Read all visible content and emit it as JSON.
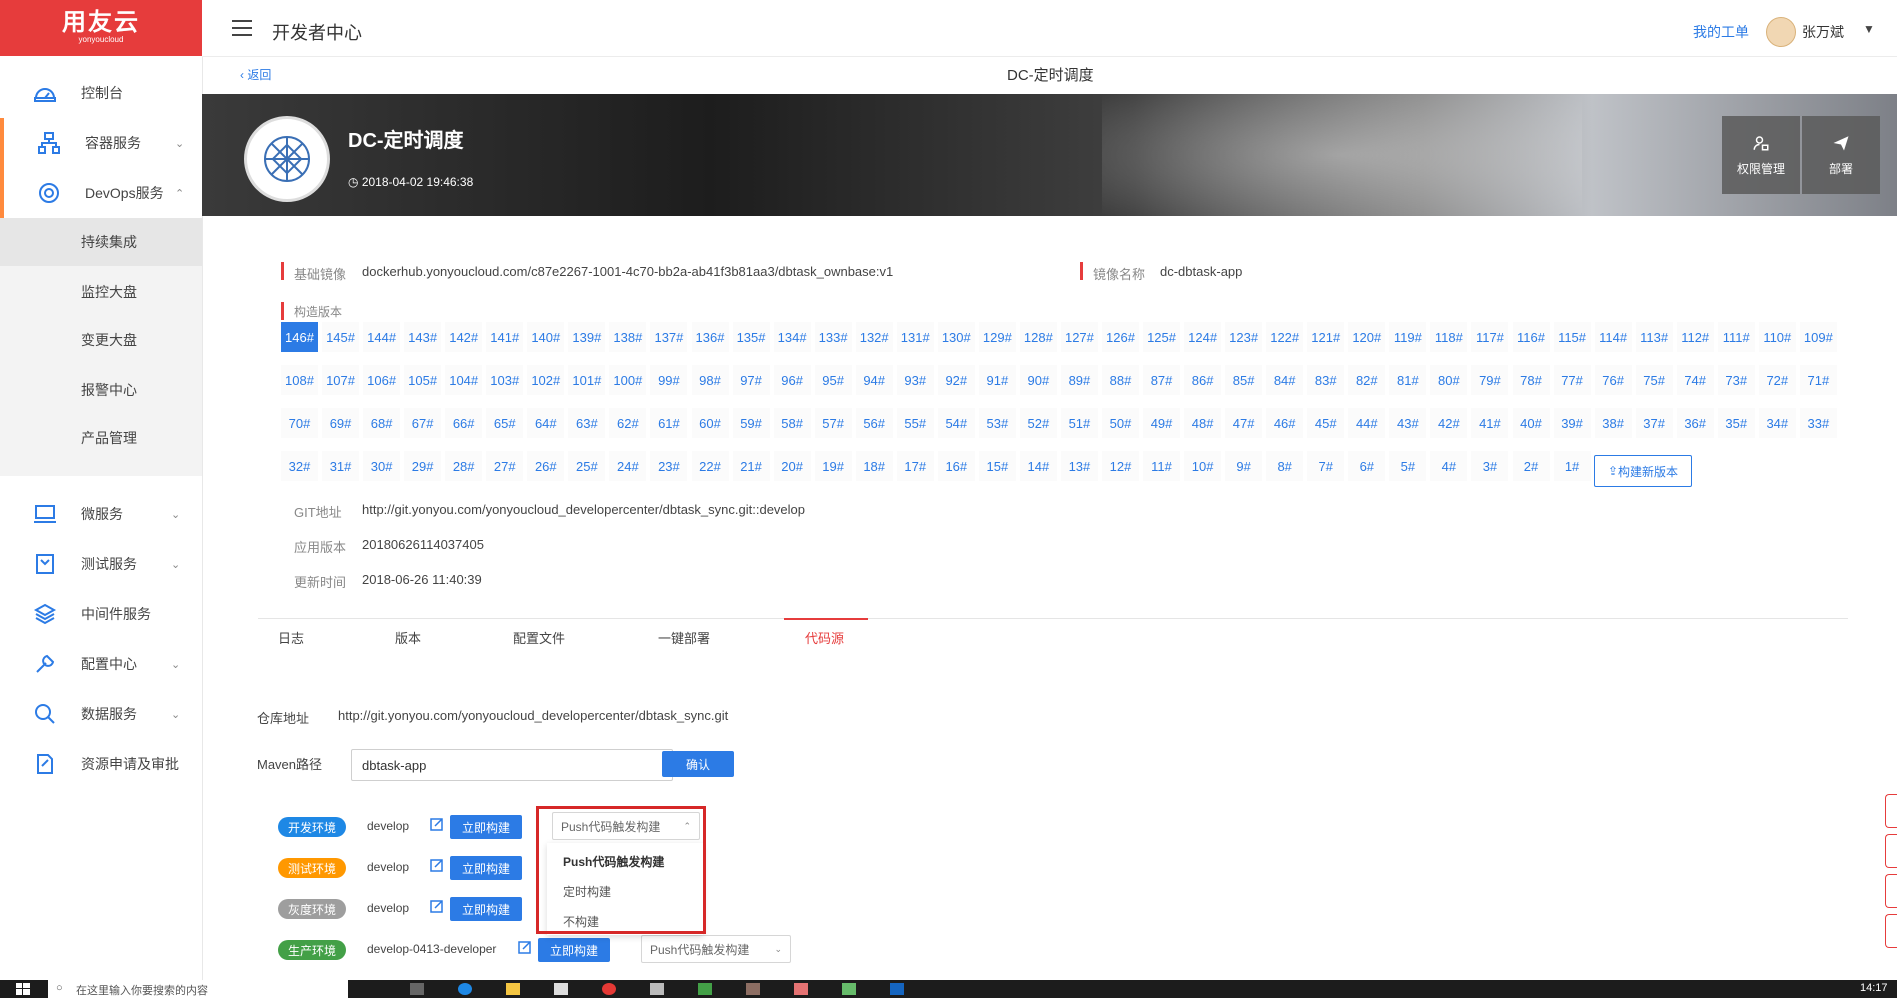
{
  "brand": {
    "name": "用友云",
    "sub": "yonyoucloud",
    "color": "#e63c3c"
  },
  "topbar": {
    "title": "开发者中心",
    "my_ticket": "我的工单",
    "username": "张万斌"
  },
  "sidebar": {
    "items": [
      {
        "label": "控制台",
        "icon": "dashboard-icon",
        "chevron": ""
      },
      {
        "label": "容器服务",
        "icon": "container-icon",
        "chevron": "⌄"
      },
      {
        "label": "DevOps服务",
        "icon": "devops-icon",
        "chevron": "⌃"
      },
      {
        "label": "微服务",
        "icon": "laptop-icon",
        "chevron": "⌄"
      },
      {
        "label": "测试服务",
        "icon": "test-icon",
        "chevron": "⌄"
      },
      {
        "label": "中间件服务",
        "icon": "layers-icon",
        "chevron": ""
      },
      {
        "label": "配置中心",
        "icon": "wrench-icon",
        "chevron": "⌄"
      },
      {
        "label": "数据服务",
        "icon": "search-data-icon",
        "chevron": "⌄"
      },
      {
        "label": "资源申请及审批",
        "icon": "approval-icon",
        "chevron": ""
      }
    ],
    "subitems": [
      "持续集成",
      "监控大盘",
      "变更大盘",
      "报警中心",
      "产品管理"
    ]
  },
  "header": {
    "back": "返回",
    "page_title": "DC-定时调度"
  },
  "app": {
    "name": "DC-定时调度",
    "date": "2018-04-02 19:46:38",
    "buttons": [
      {
        "label": "权限管理",
        "icon": "user-lock-icon"
      },
      {
        "label": "部署",
        "icon": "send-icon"
      }
    ]
  },
  "info": {
    "base_image_label": "基础镜像",
    "base_image": "dockerhub.yonyoucloud.com/c87e2267-1001-4c70-bb2a-ab41f3b81aa3/dbtask_ownbase:v1",
    "image_name_label": "镜像名称",
    "image_name": "dc-dbtask-app",
    "build_version_label": "构造版本",
    "git_label": "GIT地址",
    "git": "http://git.yonyou.com/yonyoucloud_developercenter/dbtask_sync.git::develop",
    "app_version_label": "应用版本",
    "app_version": "20180626114037405",
    "update_time_label": "更新时间",
    "update_time": "2018-06-26 11:40:39"
  },
  "versions": [
    "146#",
    "145#",
    "144#",
    "143#",
    "142#",
    "141#",
    "140#",
    "139#",
    "138#",
    "137#",
    "136#",
    "135#",
    "134#",
    "133#",
    "132#",
    "131#",
    "130#",
    "129#",
    "128#",
    "127#",
    "126#",
    "125#",
    "124#",
    "123#",
    "122#",
    "121#",
    "120#",
    "119#",
    "118#",
    "117#",
    "116#",
    "115#",
    "114#",
    "113#",
    "112#",
    "111#",
    "110#",
    "109#",
    "108#",
    "107#",
    "106#",
    "105#",
    "104#",
    "103#",
    "102#",
    "101#",
    "100#",
    "99#",
    "98#",
    "97#",
    "96#",
    "95#",
    "94#",
    "93#",
    "92#",
    "91#",
    "90#",
    "89#",
    "88#",
    "87#",
    "86#",
    "85#",
    "84#",
    "83#",
    "82#",
    "81#",
    "80#",
    "79#",
    "78#",
    "77#",
    "76#",
    "75#",
    "74#",
    "73#",
    "72#",
    "71#",
    "70#",
    "69#",
    "68#",
    "67#",
    "66#",
    "65#",
    "64#",
    "63#",
    "62#",
    "61#",
    "60#",
    "59#",
    "58#",
    "57#",
    "56#",
    "55#",
    "54#",
    "53#",
    "52#",
    "51#",
    "50#",
    "49#",
    "48#",
    "47#",
    "46#",
    "45#",
    "44#",
    "43#",
    "42#",
    "41#",
    "40#",
    "39#",
    "38#",
    "37#",
    "36#",
    "35#",
    "34#",
    "33#",
    "32#",
    "31#",
    "30#",
    "29#",
    "28#",
    "27#",
    "26#",
    "25#",
    "24#",
    "23#",
    "22#",
    "21#",
    "20#",
    "19#",
    "18#",
    "17#",
    "16#",
    "15#",
    "14#",
    "13#",
    "12#",
    "11#",
    "10#",
    "9#",
    "8#",
    "7#",
    "6#",
    "5#",
    "4#",
    "3#",
    "2#",
    "1#"
  ],
  "build_new": "构建新版本",
  "tabs": [
    "日志",
    "版本",
    "配置文件",
    "一键部署",
    "代码源"
  ],
  "code_source": {
    "repo_label": "仓库地址",
    "repo": "http://git.yonyou.com/yonyoucloud_developercenter/dbtask_sync.git",
    "maven_label": "Maven路径",
    "maven_value": "dbtask-app",
    "confirm": "确认",
    "build_now": "立即构建",
    "envs": [
      {
        "name": "开发环境",
        "branch": "develop",
        "color": "#1e88e5",
        "trigger": "Push代码触发构建"
      },
      {
        "name": "测试环境",
        "branch": "develop",
        "color": "#ff9800",
        "trigger": ""
      },
      {
        "name": "灰度环境",
        "branch": "develop",
        "color": "#9e9e9e",
        "trigger": ""
      },
      {
        "name": "生产环境",
        "branch": "develop-0413-developer",
        "color": "#43a047",
        "trigger": "Push代码触发构建"
      }
    ],
    "dropdown_options": [
      "Push代码触发构建",
      "定时构建",
      "不构建"
    ]
  },
  "taskbar": {
    "search_placeholder": "在这里输入你要搜索的内容",
    "time": "14:17"
  }
}
